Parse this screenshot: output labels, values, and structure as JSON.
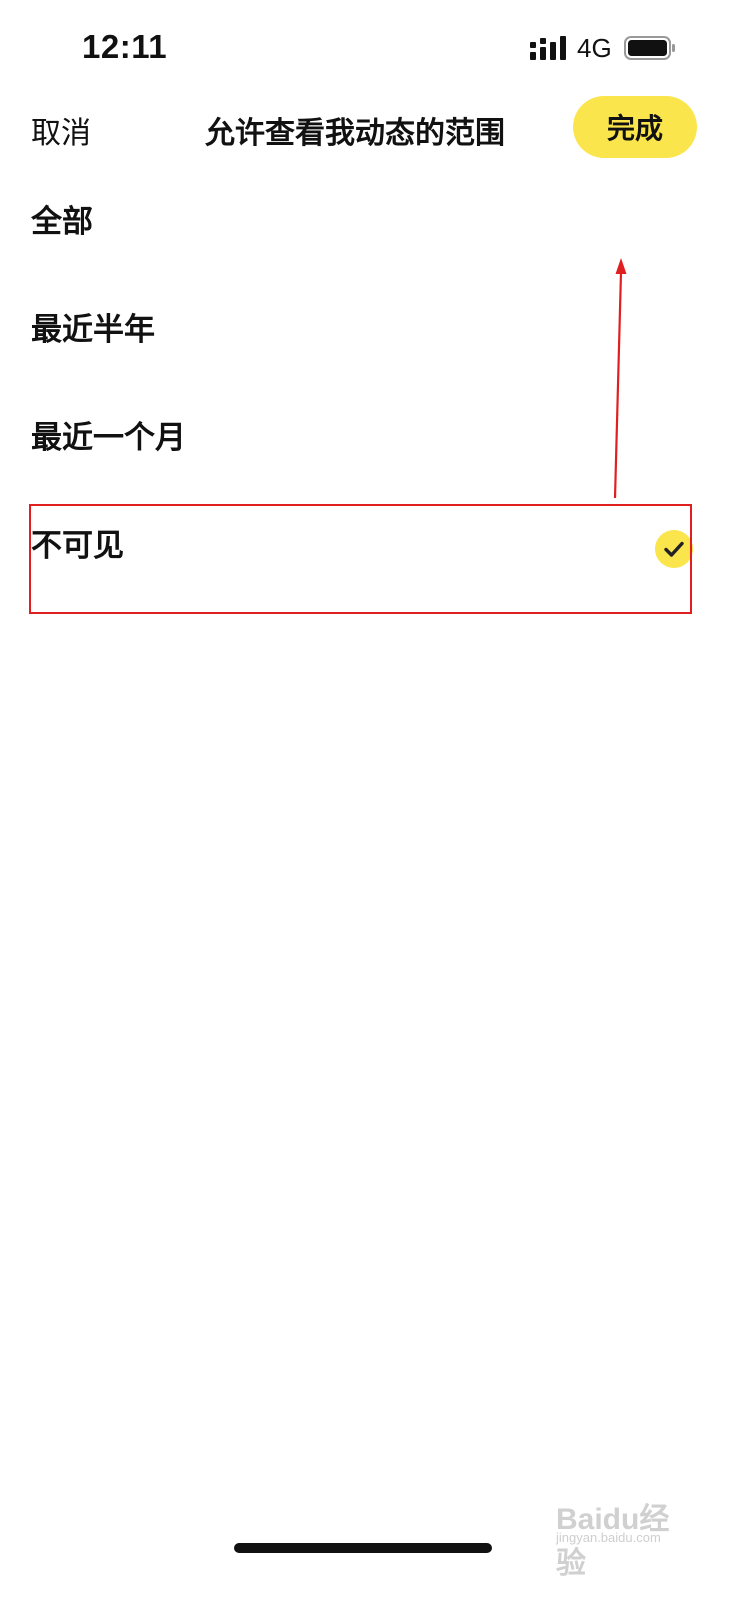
{
  "status_bar": {
    "time": "12:11",
    "network": "4G",
    "icons": [
      "signal-icon",
      "battery-icon"
    ]
  },
  "header": {
    "cancel_label": "取消",
    "title": "允许查看我动态的范围",
    "done_label": "完成"
  },
  "options": [
    {
      "label": "全部",
      "selected": false
    },
    {
      "label": "最近半年",
      "selected": false
    },
    {
      "label": "最近一个月",
      "selected": false
    },
    {
      "label": "不可见",
      "selected": true
    }
  ],
  "colors": {
    "accent": "#fbe54d",
    "annotation": "#e02020",
    "text": "#111111"
  },
  "watermark": {
    "main": "Baidu经验",
    "sub": "jingyan.baidu.com"
  }
}
